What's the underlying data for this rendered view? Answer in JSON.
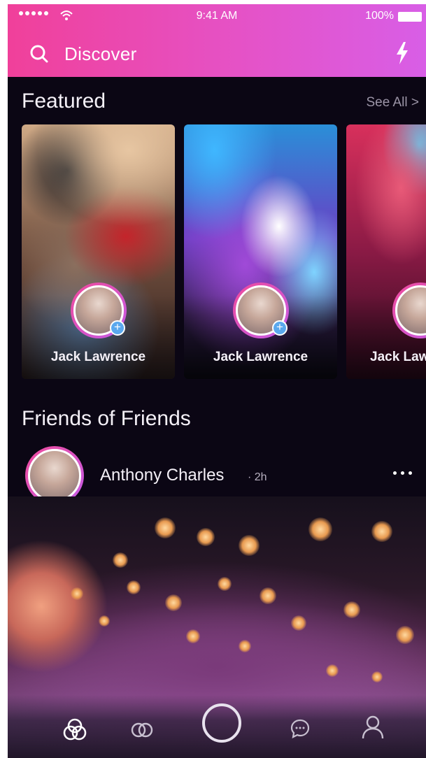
{
  "status_bar": {
    "time": "9:41 AM",
    "battery": "100%"
  },
  "header": {
    "title": "Discover",
    "search_icon": "search-icon",
    "action_icon": "lightning-bolt-icon"
  },
  "featured": {
    "title": "Featured",
    "see_all": "See All >",
    "cards": [
      {
        "name": "Jack Lawrence",
        "has_add": true
      },
      {
        "name": "Jack Lawrence",
        "has_add": true
      },
      {
        "name": "Jack Law",
        "has_add": false
      }
    ]
  },
  "friends_of_friends": {
    "title": "Friends of Friends",
    "post": {
      "author": "Anthony Charles",
      "time": "· 2h"
    }
  },
  "tabbar": {
    "tabs": [
      "discover-tab-icon",
      "friends-tab-icon",
      "record-button-icon",
      "chat-tab-icon",
      "profile-tab-icon"
    ],
    "active": "discover-tab-icon"
  },
  "colors": {
    "header_start": "#f0409a",
    "header_end": "#d85ee6",
    "background": "#0b0614",
    "accent_blue": "#5aa8ee"
  }
}
